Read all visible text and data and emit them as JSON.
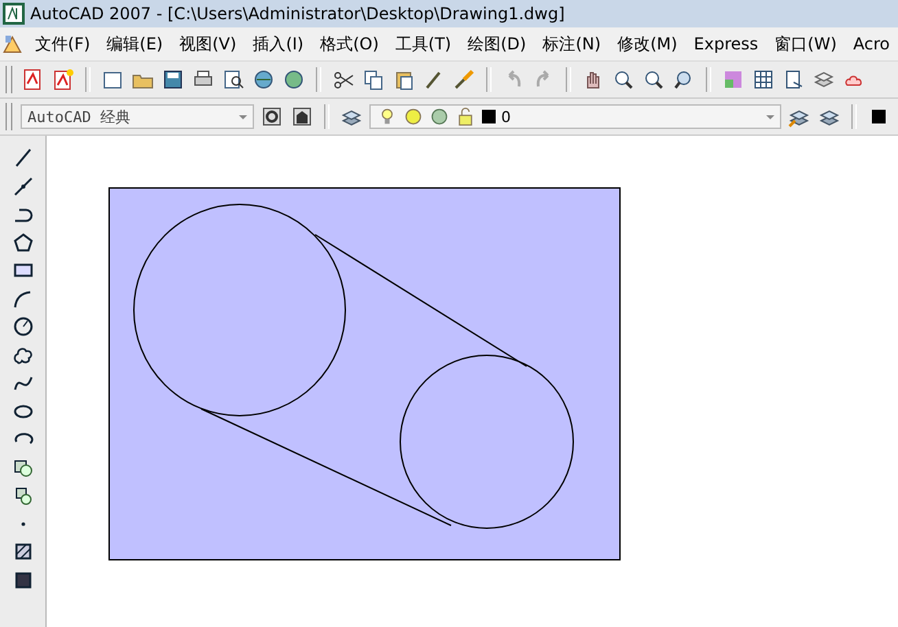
{
  "window": {
    "title": "AutoCAD 2007 - [C:\\Users\\Administrator\\Desktop\\Drawing1.dwg]"
  },
  "menu": [
    "文件(F)",
    "编辑(E)",
    "视图(V)",
    "插入(I)",
    "格式(O)",
    "工具(T)",
    "绘图(D)",
    "标注(N)",
    "修改(M)",
    "Express",
    "窗口(W)",
    "Acro"
  ],
  "workspace_combo": {
    "value": "AutoCAD 经典"
  },
  "layer_combo": {
    "value": "0"
  }
}
